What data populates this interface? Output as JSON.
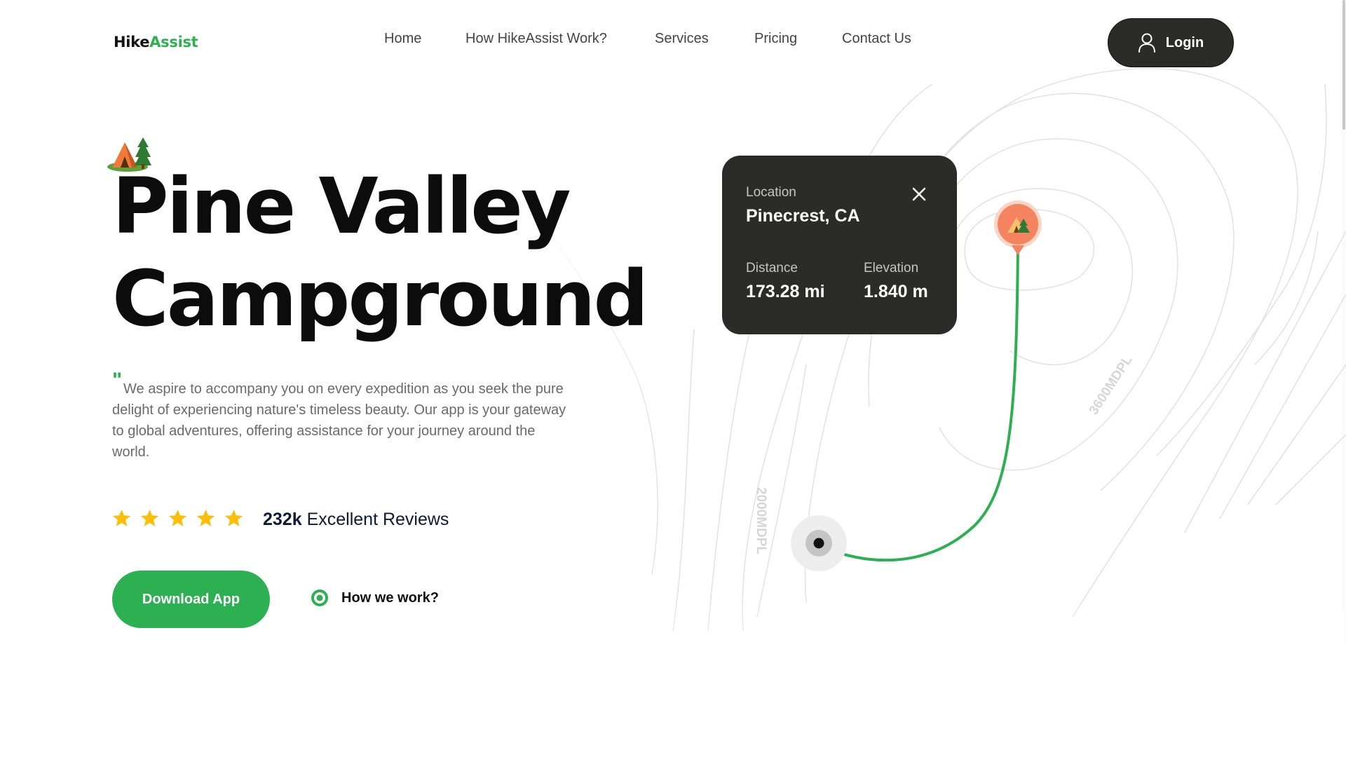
{
  "header": {
    "logo": {
      "part1": "Hike",
      "part2": "Assist"
    },
    "nav": [
      {
        "label": "Home"
      },
      {
        "label": "How HikeAssist Work?"
      },
      {
        "label": "Services"
      },
      {
        "label": "Pricing"
      },
      {
        "label": "Contact Us"
      }
    ],
    "login_label": "Login",
    "login_icon": "user-icon"
  },
  "hero": {
    "badge_icon": "camping-tent-icon",
    "title_line1": "Pine Valley",
    "title_line2": "Campground",
    "quote_mark": "\"",
    "description": "We aspire to accompany you on every expedition as you seek the pure delight of experiencing nature's timeless beauty. Our app is your gateway to global adventures, offering assistance for your journey around the world.",
    "rating": {
      "stars": 5,
      "max": 5,
      "star_color": "#fbbf0a"
    },
    "reviews_count": "232k",
    "reviews_label": "Excellent Reviews",
    "download_label": "Download App",
    "how_label": "How we work?",
    "how_icon": "play-circle-icon"
  },
  "map": {
    "contour_labels": [
      "2000MDPL",
      "3600MDPL"
    ],
    "route_color": "#2db052",
    "destination_icon": "tent-pin-icon",
    "destination_color": "#f4845f",
    "origin_icon": "current-location-icon",
    "card": {
      "location_label": "Location",
      "location_value": "Pinecrest, CA",
      "distance_label": "Distance",
      "distance_value": "173.28 mi",
      "elevation_label": "Elevation",
      "elevation_value": "1.840 m",
      "close_icon": "close-icon"
    }
  },
  "colors": {
    "brand_green": "#2db052",
    "dark": "#2b2c29",
    "text_muted": "#6a6a6a"
  }
}
